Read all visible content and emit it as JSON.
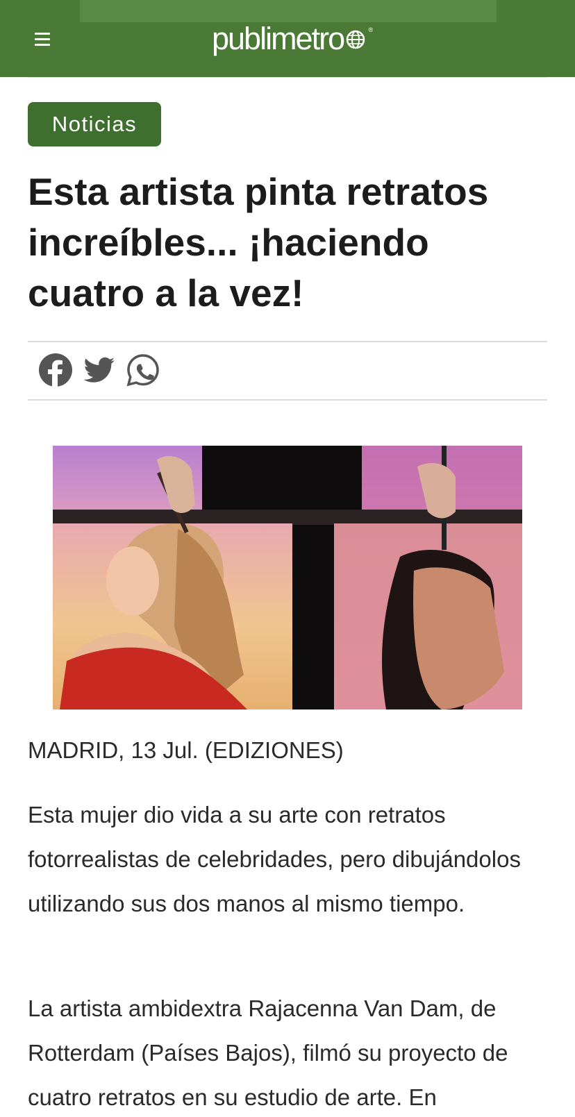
{
  "header": {
    "logo_text": "publimetro",
    "logo_mark": "®",
    "menu_icon": "hamburger-menu-icon",
    "background": "#4a7a35"
  },
  "article": {
    "category": "Noticias",
    "category_color": "#3e6f2f",
    "title": "Esta artista pinta retratos increíbles... ¡haciendo cuatro a la vez!",
    "share": {
      "icons": [
        "facebook-icon",
        "twitter-icon",
        "whatsapp-icon"
      ]
    },
    "dateline": "MADRID, 13 Jul. (EDIZIONES)",
    "paragraphs": [
      "Esta mujer dio vida a su arte con retratos fotorrealistas de celebridades, pero dibujándolos utilizando sus dos manos al mismo tiempo.",
      "La artista ambidextra Rajacenna Van Dam, de Rotterdam (Países Bajos), filmó su proyecto de cuatro retratos en su estudio de arte. En"
    ]
  }
}
